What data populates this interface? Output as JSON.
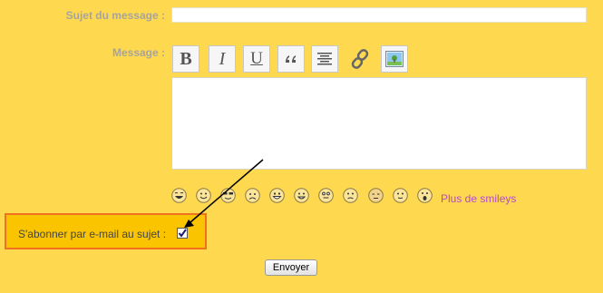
{
  "form": {
    "subject_label": "Sujet du message :",
    "subject_value": "",
    "message_label": "Message :",
    "message_value": "",
    "toolbar": [
      {
        "icon": "bold-icon",
        "glyph": "B"
      },
      {
        "icon": "italic-icon",
        "glyph": "I"
      },
      {
        "icon": "underline-icon",
        "glyph": "U"
      },
      {
        "icon": "quote-icon"
      },
      {
        "icon": "align-center-icon"
      },
      {
        "icon": "link-icon"
      },
      {
        "icon": "image-icon"
      }
    ],
    "smileys": [
      "laughing",
      "smile",
      "cool",
      "sad",
      "happy",
      "grin",
      "surprised",
      "frown",
      "shy",
      "neutral",
      "shocked"
    ],
    "more_smileys_label": "Plus de smileys",
    "subscribe_label": "S'abonner par e-mail au sujet :",
    "subscribe_checked": true,
    "send_label": "Envoyer"
  },
  "colors": {
    "background": "#fed94f",
    "highlight_box": "#fac500",
    "highlight_border": "#f0711f",
    "link": "#b64bc4",
    "label": "#a8a49a"
  }
}
